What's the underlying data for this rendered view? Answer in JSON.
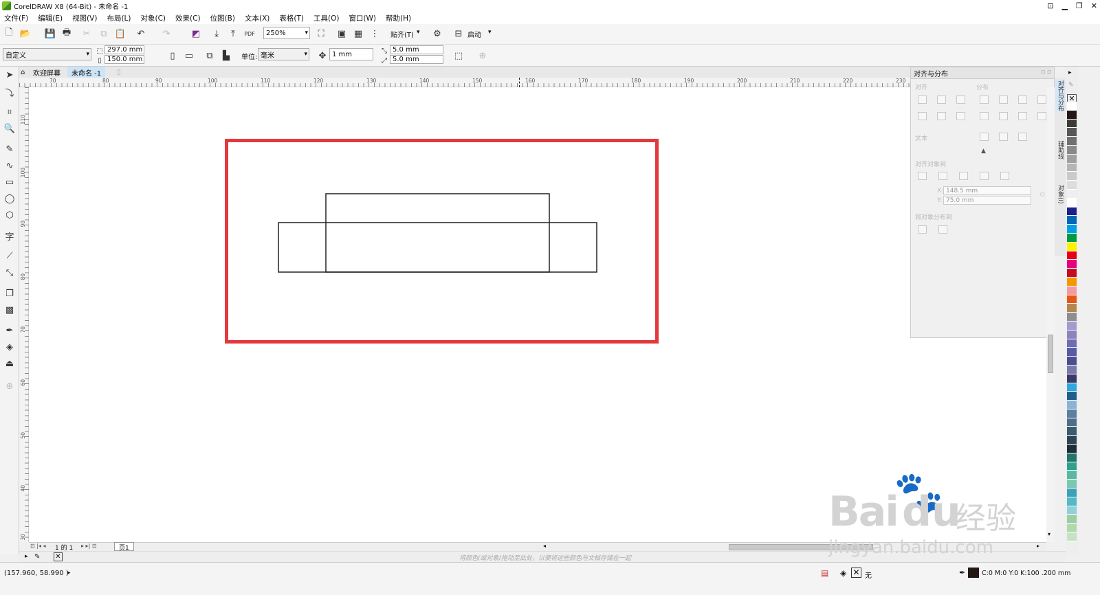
{
  "window": {
    "title": "CorelDRAW X8 (64-Bit) - 未命名 -1"
  },
  "menu": [
    "文件(F)",
    "编辑(E)",
    "视图(V)",
    "布局(L)",
    "对象(C)",
    "效果(C)",
    "位图(B)",
    "文本(X)",
    "表格(T)",
    "工具(O)",
    "窗口(W)",
    "帮助(H)"
  ],
  "toolbar": {
    "zoom": "250%",
    "snap_label": "贴齐(T)",
    "launch_label": "启动"
  },
  "propertybar": {
    "preset": "自定义",
    "width": "297.0 mm",
    "height": "150.0 mm",
    "unit_label": "单位:",
    "unit": "毫米",
    "nudge": "1 mm",
    "dup_x": "5.0 mm",
    "dup_y": "5.0 mm"
  },
  "tabs": {
    "welcome": "欢迎屏幕",
    "doc": "未命名 -1"
  },
  "ruler": {
    "h": [
      "70",
      "80",
      "90",
      "100",
      "110",
      "120",
      "130",
      "140",
      "150",
      "160",
      "170",
      "180",
      "190",
      "200",
      "210",
      "220",
      "230"
    ],
    "v": [
      "110",
      "100",
      "90",
      "80",
      "70",
      "60",
      "50",
      "40",
      "30"
    ]
  },
  "docker": {
    "title": "对齐与分布",
    "align_label": "对齐",
    "distribute_label": "分布",
    "text_label": "文本",
    "align_to_label": "对齐对象到",
    "x": "148.5 mm",
    "y": "75.0 mm",
    "x_label": "X:",
    "y_label": "Y:",
    "distribute_to_label": "将对象分布到"
  },
  "vtabs": [
    "对齐与分布",
    "辅助线",
    "对象(I)"
  ],
  "palette": [
    "#ffffff",
    "#231815",
    "#3e3a39",
    "#595757",
    "#727171",
    "#898989",
    "#9fa0a0",
    "#b5b5b6",
    "#c9caca",
    "#dcdddd",
    "#efefef",
    "#ffffff",
    "#1d2088",
    "#0068b7",
    "#00a0e9",
    "#009944",
    "#fff100",
    "#e60012",
    "#e4007f",
    "#c30d23",
    "#f39800",
    "#f29c9f",
    "#ea5514",
    "#b28850",
    "#8e8e8e",
    "#a29bcd",
    "#8f82bc",
    "#6c6db5",
    "#5a5aa5",
    "#4d4d8f",
    "#7a7aa8",
    "#3a3a6a",
    "#2ea7e0",
    "#1f5f8b",
    "#8ab4d6",
    "#5b7fa1",
    "#4e6f8a",
    "#3c5a70",
    "#2d4555",
    "#1e2f3a",
    "#23746f",
    "#32a088",
    "#56b9a0",
    "#7cc7b1",
    "#3ba2b8",
    "#55b7c8",
    "#8fd0d9",
    "#9fcca0",
    "#b2d8b0",
    "#c6e3c1"
  ],
  "pager": {
    "count": "1 的 1",
    "page_tab": "页1"
  },
  "hint": "将颜色(或对象)拖动至此处，以便将这些颜色与文档存储在一起",
  "status": {
    "coords": "(157.960, 58.990 )",
    "fill_label": "无",
    "outline": "C:0 M:0 Y:0 K:100  .200 mm"
  },
  "watermark": {
    "brand": "Bai",
    "brand2": "du",
    "cn": "经验",
    "url": "jingyan.baidu.com"
  }
}
